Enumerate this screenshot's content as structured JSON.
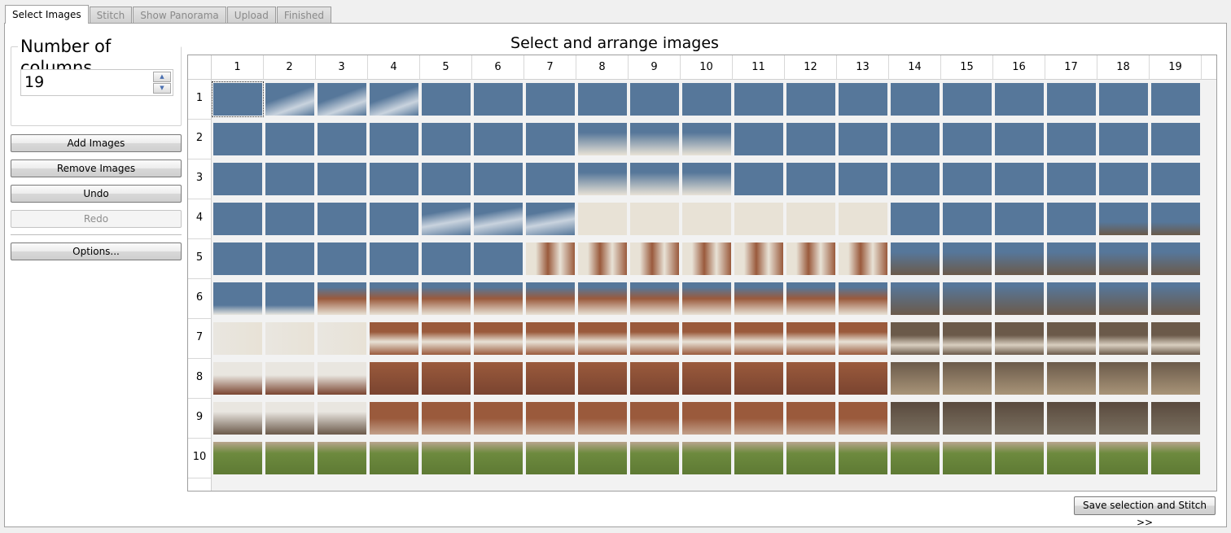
{
  "tabs": [
    {
      "label": "Select Images",
      "active": true
    },
    {
      "label": "Stitch",
      "active": false
    },
    {
      "label": "Show Panorama",
      "active": false
    },
    {
      "label": "Upload",
      "active": false
    },
    {
      "label": "Finished",
      "active": false
    }
  ],
  "columns_group": {
    "title": "Number of columns",
    "value": "19"
  },
  "buttons": {
    "add": "Add Images",
    "remove": "Remove Images",
    "undo": "Undo",
    "redo": "Redo",
    "options": "Options...",
    "save": "Save selection and Stitch >>"
  },
  "main_title": "Select and arrange images",
  "grid": {
    "columns": [
      "1",
      "2",
      "3",
      "4",
      "5",
      "6",
      "7",
      "8",
      "9",
      "10",
      "11",
      "12",
      "13",
      "14",
      "15",
      "16",
      "17",
      "18",
      "19"
    ],
    "rows": [
      "1",
      "2",
      "3",
      "4",
      "5",
      "6",
      "7",
      "8",
      "9",
      "10"
    ],
    "selected_cell": "r1c1"
  },
  "colors": {
    "sky": "#56779a",
    "cloud": "#c9d3de",
    "brick": "#9a5a3c",
    "brick_dark": "#7a4430",
    "marble": "#e8e2d6",
    "plaster": "#e9e6e0",
    "trees": "#6b5a4a",
    "grass": "#6d8a3e"
  }
}
